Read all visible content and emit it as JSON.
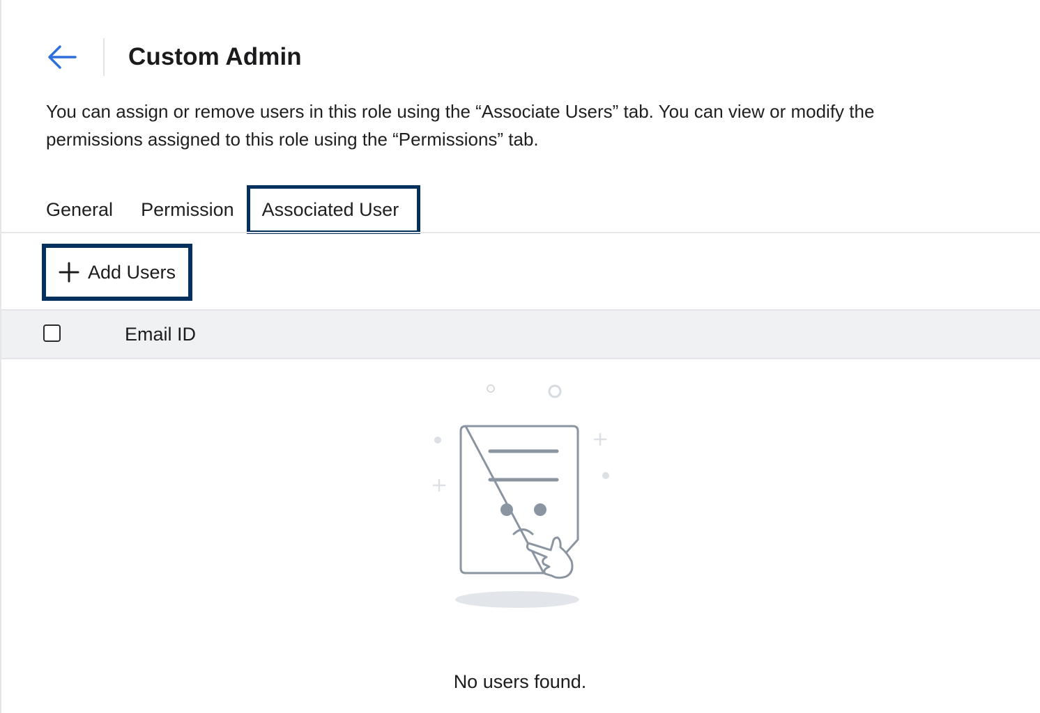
{
  "header": {
    "back_icon": "arrow-left-icon",
    "title": "Custom Admin"
  },
  "description": "You can assign or remove users in this role using the “Associate Users” tab. You can view or modify the permissions assigned to this role using the “Permissions” tab.",
  "tabs": [
    {
      "label": "General",
      "active": false
    },
    {
      "label": "Permission",
      "active": false
    },
    {
      "label": "Associated User",
      "active": true
    }
  ],
  "toolbar": {
    "add_users_icon": "plus-icon",
    "add_users_label": "Add Users"
  },
  "table": {
    "select_all_checked": false,
    "columns": [
      "Email ID"
    ],
    "rows": []
  },
  "empty_state": {
    "illustration": "confused-document-illustration",
    "message": "No users found."
  },
  "colors": {
    "accent": "#2f6fdc",
    "focus_outline": "#04305e",
    "header_bg": "#f0f1f3",
    "illustration_stroke": "#8a95a1"
  }
}
